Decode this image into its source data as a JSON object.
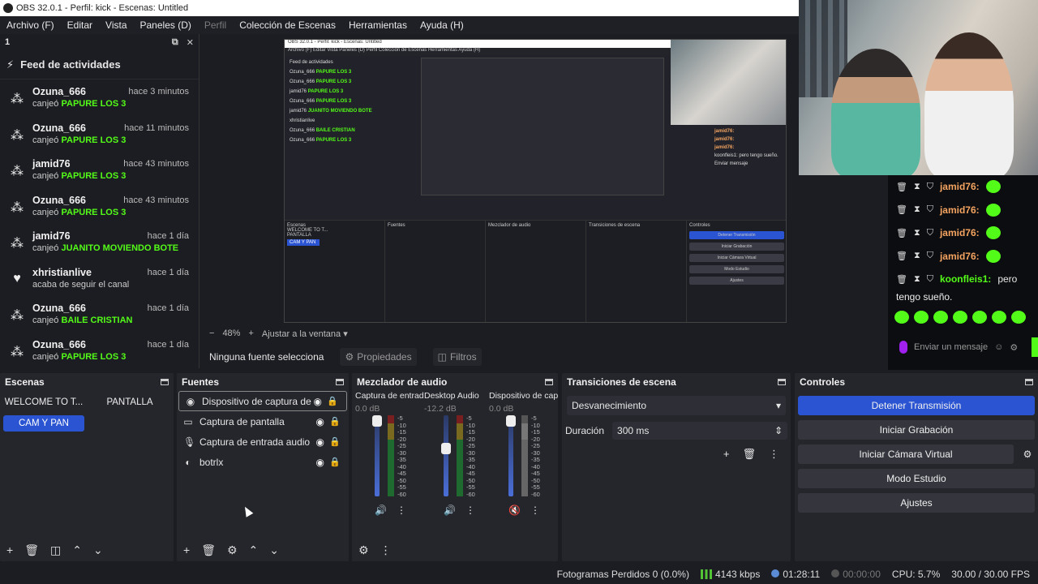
{
  "window": {
    "title": "OBS 32.0.1 - Perfil: kick - Escenas: Untitled"
  },
  "menu": [
    "Archivo (F)",
    "Editar",
    "Vista",
    "Paneles (D)",
    "Perfil",
    "Colección de Escenas",
    "Herramientas",
    "Ayuda (H)"
  ],
  "feed": {
    "dock_title": "1",
    "title": "Feed de actividades",
    "items": [
      {
        "user": "Ozuna_666",
        "time": "hace 3 minutos",
        "verb": "canjeó",
        "reward": "PAPURE LOS 3",
        "icon": "reward-icon"
      },
      {
        "user": "Ozuna_666",
        "time": "hace 11 minutos",
        "verb": "canjeó",
        "reward": "PAPURE LOS 3",
        "icon": "reward-icon"
      },
      {
        "user": "jamid76",
        "time": "hace 43 minutos",
        "verb": "canjeó",
        "reward": "PAPURE LOS 3",
        "icon": "reward-icon"
      },
      {
        "user": "Ozuna_666",
        "time": "hace 43 minutos",
        "verb": "canjeó",
        "reward": "PAPURE LOS 3",
        "icon": "reward-icon"
      },
      {
        "user": "jamid76",
        "time": "hace 1 día",
        "verb": "canjeó",
        "reward": "JUANITO MOVIENDO BOTE",
        "icon": "reward-icon"
      },
      {
        "user": "xhristianlive",
        "time": "hace 1 día",
        "verb": "acaba de seguir el canal",
        "reward": "",
        "icon": "heart-icon"
      },
      {
        "user": "Ozuna_666",
        "time": "hace 1 día",
        "verb": "canjeó",
        "reward": "BAILE CRISTIAN",
        "icon": "reward-icon"
      },
      {
        "user": "Ozuna_666",
        "time": "hace 1 día",
        "verb": "canjeó",
        "reward": "PAPURE LOS 3",
        "icon": "reward-icon"
      }
    ]
  },
  "nested": {
    "title": "OBS 32.0.1 - Perfil: kick - Escenas: Untitled",
    "menu": "Archivo (F)  Editar  Vista  Paneles (D)  Perfil  Colección de Escenas  Herramientas  Ayuda (H)",
    "feed_title": "Feed de actividades",
    "source_bar": "Ninguna fuente seleccionada",
    "scenes": "Escenas",
    "sources": "Fuentes",
    "mixer": "Mezclador de audio",
    "transitions": "Transiciones de escena",
    "controls": "Controles",
    "btn_stop": "Detener Transmisión",
    "btn_rec": "Iniciar Grabación",
    "btn_cam": "Iniciar Cámara Virtual",
    "btn_studio": "Modo Estudio",
    "btn_settings": "Ajustes",
    "chat_send": "Enviar mensaje",
    "chat_line_1": "jamid76:",
    "chat_line_2": "koonfleis1: pero tengo sueño.",
    "scene_a": "WELCOME TO T...",
    "scene_b": "PANTALLA",
    "scene_c": "CAM Y PAN"
  },
  "preview_bar": {
    "zoom": "48%",
    "fit": "Ajustar a la ventana"
  },
  "source_toolbar": {
    "none_selected": "Ninguna fuente selecciona",
    "properties": "Propiedades",
    "filters": "Filtros"
  },
  "chat": {
    "lines": [
      {
        "user": "jamid76:"
      },
      {
        "user": "jamid76:"
      },
      {
        "user": "jamid76:"
      },
      {
        "user": "jamid76:"
      }
    ],
    "message_user": "koonfleis1:",
    "message_text_1": "pero",
    "message_text_2": "tengo sueño.",
    "send_placeholder": "Enviar un mensaje"
  },
  "scenes": {
    "title": "Escenas",
    "items": [
      {
        "label": "WELCOME TO T...",
        "active": false
      },
      {
        "label": "PANTALLA",
        "active": false
      },
      {
        "label": "CAM Y PAN",
        "active": true
      }
    ]
  },
  "sources": {
    "title": "Fuentes",
    "items": [
      {
        "label": "Dispositivo de captura de v",
        "icon": "camera-icon",
        "selected": true
      },
      {
        "label": "Captura de pantalla",
        "icon": "monitor-icon",
        "selected": false
      },
      {
        "label": "Captura de entrada audio",
        "icon": "microphone-icon",
        "selected": false
      },
      {
        "label": "botrlx",
        "icon": "browser-icon",
        "selected": false
      }
    ]
  },
  "mixer": {
    "title": "Mezclador de audio",
    "channels": [
      {
        "name": "Captura de entrada",
        "db": "0.0 dB",
        "level": 1.0,
        "muted": false
      },
      {
        "name": "Desktop Audio",
        "db": "-12.2 dB",
        "level": 0.6,
        "muted": false
      },
      {
        "name": "Dispositivo de capt",
        "db": "0.0 dB",
        "level": 1.0,
        "muted": true
      }
    ],
    "scale": [
      "-5",
      "-10",
      "-15",
      "-20",
      "-25",
      "-30",
      "-35",
      "-40",
      "-45",
      "-50",
      "-55",
      "-60"
    ]
  },
  "transitions": {
    "title": "Transiciones de escena",
    "selected": "Desvanecimiento",
    "duration_label": "Duración",
    "duration_value": "300 ms"
  },
  "controls": {
    "title": "Controles",
    "stop_stream": "Detener Transmisión",
    "start_recording": "Iniciar Grabación",
    "start_virtual_cam": "Iniciar Cámara Virtual",
    "studio_mode": "Modo Estudio",
    "settings": "Ajustes"
  },
  "status": {
    "dropped_frames": "Fotogramas Perdidos 0 (0.0%)",
    "bitrate": "4143 kbps",
    "stream_time": "01:28:11",
    "rec_time": "00:00:00",
    "cpu": "CPU: 5.7%",
    "fps": "30.00 / 30.00 FPS"
  },
  "colors": {
    "accent": "#2a54d1",
    "kick_green": "#53fc18",
    "username_orange": "#f4a460"
  }
}
